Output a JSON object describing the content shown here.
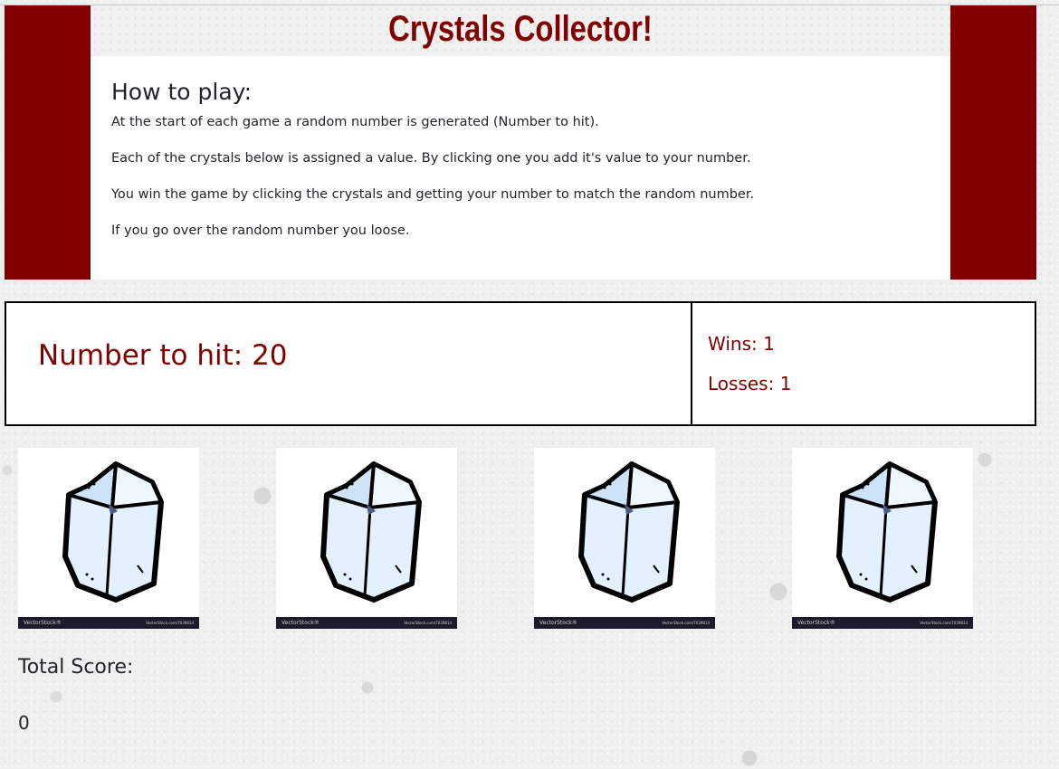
{
  "header": {
    "title": "Crystals Collector!",
    "how_to_play_heading": "How to play:",
    "instructions": [
      "At the start of each game a random number is generated (Number to hit).",
      "Each of the crystals below is assigned a value. By clicking one you add it's value to your number.",
      "You win the game by clicking the crystals and getting your number to match the random number.",
      "If you go over the random number you loose."
    ]
  },
  "scoreboard": {
    "target_text": "Number to hit: 20",
    "wins_text": "Wins: 1",
    "losses_text": "Losses: 1"
  },
  "crystals": [
    {
      "icon": "crystal-icon",
      "watermark_left": "VectorStock®",
      "watermark_right": "VectorStock.com/7039814"
    },
    {
      "icon": "crystal-icon",
      "watermark_left": "VectorStock®",
      "watermark_right": "VectorStock.com/7039814"
    },
    {
      "icon": "crystal-icon",
      "watermark_left": "VectorStock®",
      "watermark_right": "VectorStock.com/7039814"
    },
    {
      "icon": "crystal-icon",
      "watermark_left": "VectorStock®",
      "watermark_right": "VectorStock.com/7039814"
    }
  ],
  "score": {
    "label": "Total Score:",
    "value": "0"
  },
  "colors": {
    "accent": "#800000",
    "crystal_fill": "#dfeefc",
    "crystal_outline": "#000000"
  }
}
